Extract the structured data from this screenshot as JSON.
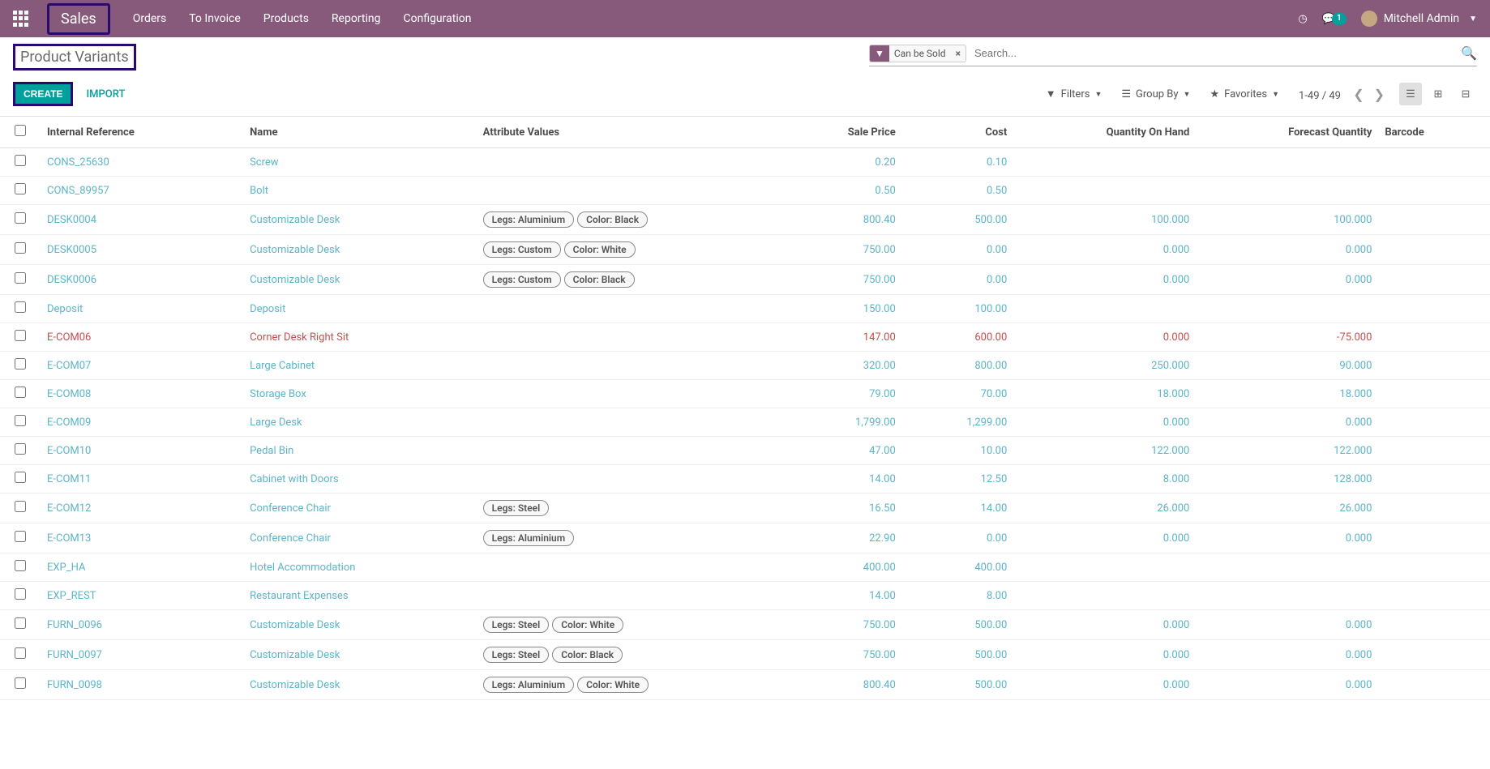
{
  "nav": {
    "app_name": "Sales",
    "menu": [
      "Orders",
      "To Invoice",
      "Products",
      "Reporting",
      "Configuration"
    ],
    "chat_count": "1",
    "user_name": "Mitchell Admin"
  },
  "control": {
    "page_title": "Product Variants",
    "create_label": "CREATE",
    "import_label": "IMPORT",
    "search_facet_label": "Can be Sold",
    "search_placeholder": "Search...",
    "filters_label": "Filters",
    "groupby_label": "Group By",
    "favorites_label": "Favorites",
    "pager_text": "1-49 / 49"
  },
  "table": {
    "headers": {
      "internal_ref": "Internal Reference",
      "name": "Name",
      "attr_values": "Attribute Values",
      "sale_price": "Sale Price",
      "cost": "Cost",
      "qty_on_hand": "Quantity On Hand",
      "forecast_qty": "Forecast Quantity",
      "barcode": "Barcode"
    },
    "rows": [
      {
        "ref": "CONS_25630",
        "name": "Screw",
        "attrs": [],
        "sale": "0.20",
        "cost": "0.10",
        "qty": "",
        "forecast": "",
        "red": false
      },
      {
        "ref": "CONS_89957",
        "name": "Bolt",
        "attrs": [],
        "sale": "0.50",
        "cost": "0.50",
        "qty": "",
        "forecast": "",
        "red": false
      },
      {
        "ref": "DESK0004",
        "name": "Customizable Desk",
        "attrs": [
          "Legs: Aluminium",
          "Color: Black"
        ],
        "sale": "800.40",
        "cost": "500.00",
        "qty": "100.000",
        "forecast": "100.000",
        "red": false
      },
      {
        "ref": "DESK0005",
        "name": "Customizable Desk",
        "attrs": [
          "Legs: Custom",
          "Color: White"
        ],
        "sale": "750.00",
        "cost": "0.00",
        "qty": "0.000",
        "forecast": "0.000",
        "red": false
      },
      {
        "ref": "DESK0006",
        "name": "Customizable Desk",
        "attrs": [
          "Legs: Custom",
          "Color: Black"
        ],
        "sale": "750.00",
        "cost": "0.00",
        "qty": "0.000",
        "forecast": "0.000",
        "red": false
      },
      {
        "ref": "Deposit",
        "name": "Deposit",
        "attrs": [],
        "sale": "150.00",
        "cost": "100.00",
        "qty": "",
        "forecast": "",
        "red": false
      },
      {
        "ref": "E-COM06",
        "name": "Corner Desk Right Sit",
        "attrs": [],
        "sale": "147.00",
        "cost": "600.00",
        "qty": "0.000",
        "forecast": "-75.000",
        "red": true
      },
      {
        "ref": "E-COM07",
        "name": "Large Cabinet",
        "attrs": [],
        "sale": "320.00",
        "cost": "800.00",
        "qty": "250.000",
        "forecast": "90.000",
        "red": false
      },
      {
        "ref": "E-COM08",
        "name": "Storage Box",
        "attrs": [],
        "sale": "79.00",
        "cost": "70.00",
        "qty": "18.000",
        "forecast": "18.000",
        "red": false
      },
      {
        "ref": "E-COM09",
        "name": "Large Desk",
        "attrs": [],
        "sale": "1,799.00",
        "cost": "1,299.00",
        "qty": "0.000",
        "forecast": "0.000",
        "red": false
      },
      {
        "ref": "E-COM10",
        "name": "Pedal Bin",
        "attrs": [],
        "sale": "47.00",
        "cost": "10.00",
        "qty": "122.000",
        "forecast": "122.000",
        "red": false
      },
      {
        "ref": "E-COM11",
        "name": "Cabinet with Doors",
        "attrs": [],
        "sale": "14.00",
        "cost": "12.50",
        "qty": "8.000",
        "forecast": "128.000",
        "red": false
      },
      {
        "ref": "E-COM12",
        "name": "Conference Chair",
        "attrs": [
          "Legs: Steel"
        ],
        "sale": "16.50",
        "cost": "14.00",
        "qty": "26.000",
        "forecast": "26.000",
        "red": false
      },
      {
        "ref": "E-COM13",
        "name": "Conference Chair",
        "attrs": [
          "Legs: Aluminium"
        ],
        "sale": "22.90",
        "cost": "0.00",
        "qty": "0.000",
        "forecast": "0.000",
        "red": false
      },
      {
        "ref": "EXP_HA",
        "name": "Hotel Accommodation",
        "attrs": [],
        "sale": "400.00",
        "cost": "400.00",
        "qty": "",
        "forecast": "",
        "red": false
      },
      {
        "ref": "EXP_REST",
        "name": "Restaurant Expenses",
        "attrs": [],
        "sale": "14.00",
        "cost": "8.00",
        "qty": "",
        "forecast": "",
        "red": false
      },
      {
        "ref": "FURN_0096",
        "name": "Customizable Desk",
        "attrs": [
          "Legs: Steel",
          "Color: White"
        ],
        "sale": "750.00",
        "cost": "500.00",
        "qty": "0.000",
        "forecast": "0.000",
        "red": false
      },
      {
        "ref": "FURN_0097",
        "name": "Customizable Desk",
        "attrs": [
          "Legs: Steel",
          "Color: Black"
        ],
        "sale": "750.00",
        "cost": "500.00",
        "qty": "0.000",
        "forecast": "0.000",
        "red": false
      },
      {
        "ref": "FURN_0098",
        "name": "Customizable Desk",
        "attrs": [
          "Legs: Aluminium",
          "Color: White"
        ],
        "sale": "800.40",
        "cost": "500.00",
        "qty": "0.000",
        "forecast": "0.000",
        "red": false
      }
    ]
  }
}
